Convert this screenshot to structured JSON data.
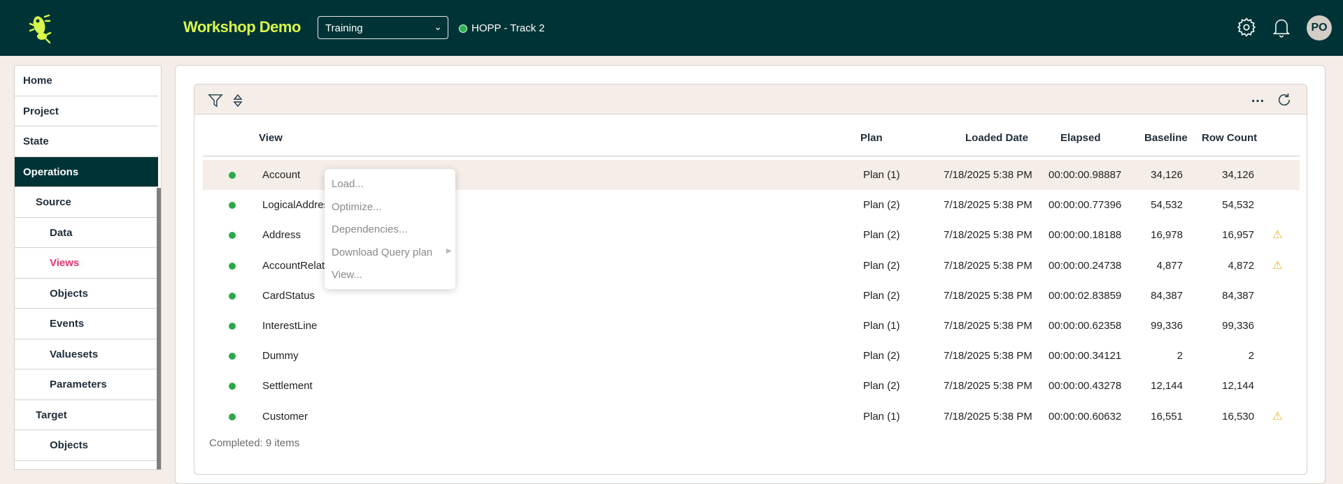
{
  "header": {
    "title": "Workshop Demo",
    "environment_select": "Training",
    "connection": "HOPP - Track 2",
    "avatar": "PO",
    "colors": {
      "bar": "#003336",
      "brand": "#d9f74a",
      "connected": "#2eb24a"
    }
  },
  "sidebar": {
    "items": [
      {
        "label": "Home",
        "level": 1
      },
      {
        "label": "Project",
        "level": 1
      },
      {
        "label": "State",
        "level": 1
      },
      {
        "label": "Operations",
        "level": 1,
        "active": true
      },
      {
        "label": "Source",
        "level": 2
      },
      {
        "label": "Data",
        "level": 3
      },
      {
        "label": "Views",
        "level": 3,
        "selected": true
      },
      {
        "label": "Objects",
        "level": 3
      },
      {
        "label": "Events",
        "level": 3
      },
      {
        "label": "Valuesets",
        "level": 3
      },
      {
        "label": "Parameters",
        "level": 3
      },
      {
        "label": "Target",
        "level": 2
      },
      {
        "label": "Objects",
        "level": 3
      }
    ]
  },
  "grid": {
    "columns": {
      "view": "View",
      "plan": "Plan",
      "loaded": "Loaded Date",
      "elapsed": "Elapsed",
      "baseline": "Baseline",
      "rowcount": "Row Count"
    },
    "rows": [
      {
        "view": "Account",
        "plan": "Plan (1)",
        "loaded": "7/18/2025 5:38 PM",
        "elapsed": "00:00:00.98887",
        "baseline": "34,126",
        "rowcount": "34,126",
        "warning": false
      },
      {
        "view": "LogicalAddress",
        "plan": "Plan (2)",
        "loaded": "7/18/2025 5:38 PM",
        "elapsed": "00:00:00.77396",
        "baseline": "54,532",
        "rowcount": "54,532",
        "warning": false
      },
      {
        "view": "Address",
        "plan": "Plan (2)",
        "loaded": "7/18/2025 5:38 PM",
        "elapsed": "00:00:00.18188",
        "baseline": "16,978",
        "rowcount": "16,957",
        "warning": true
      },
      {
        "view": "AccountRelated",
        "plan": "Plan (2)",
        "loaded": "7/18/2025 5:38 PM",
        "elapsed": "00:00:00.24738",
        "baseline": "4,877",
        "rowcount": "4,872",
        "warning": true
      },
      {
        "view": "CardStatus",
        "plan": "Plan (2)",
        "loaded": "7/18/2025 5:38 PM",
        "elapsed": "00:00:02.83859",
        "baseline": "84,387",
        "rowcount": "84,387",
        "warning": false
      },
      {
        "view": "InterestLine",
        "plan": "Plan (1)",
        "loaded": "7/18/2025 5:38 PM",
        "elapsed": "00:00:00.62358",
        "baseline": "99,336",
        "rowcount": "99,336",
        "warning": false
      },
      {
        "view": "Dummy",
        "plan": "Plan (2)",
        "loaded": "7/18/2025 5:38 PM",
        "elapsed": "00:00:00.34121",
        "baseline": "2",
        "rowcount": "2",
        "warning": false
      },
      {
        "view": "Settlement",
        "plan": "Plan (2)",
        "loaded": "7/18/2025 5:38 PM",
        "elapsed": "00:00:00.43278",
        "baseline": "12,144",
        "rowcount": "12,144",
        "warning": false
      },
      {
        "view": "Customer",
        "plan": "Plan (1)",
        "loaded": "7/18/2025 5:38 PM",
        "elapsed": "00:00:00.60632",
        "baseline": "16,551",
        "rowcount": "16,530",
        "warning": true
      }
    ],
    "footer": "Completed: 9 items"
  },
  "context_menu": {
    "items": [
      "Load...",
      "Optimize...",
      "Dependencies...",
      "Download Query plan",
      "View..."
    ]
  }
}
